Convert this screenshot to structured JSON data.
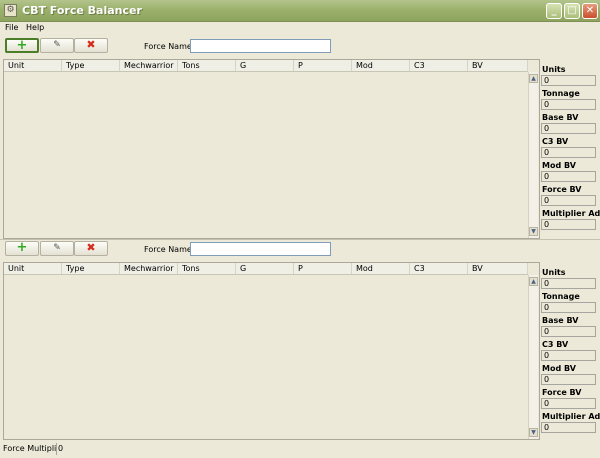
{
  "window": {
    "title": "CBT Force Balancer",
    "minimize_label": "_",
    "maximize_label": "□",
    "close_label": "✕"
  },
  "menu": {
    "items": [
      "File",
      "Help"
    ]
  },
  "toolbar": {
    "add_icon": "+",
    "edit_icon": "✎",
    "delete_icon": "✖"
  },
  "force1": {
    "force_name_label": "Force Name:",
    "force_name_value": "",
    "columns": [
      "Unit",
      "Type",
      "Mechwarrior",
      "Tons",
      "G",
      "P",
      "Mod",
      "C3",
      "BV"
    ],
    "stats": [
      {
        "label": "Units",
        "value": "0"
      },
      {
        "label": "Tonnage",
        "value": "0"
      },
      {
        "label": "Base BV",
        "value": "0"
      },
      {
        "label": "C3 BV",
        "value": "0"
      },
      {
        "label": "Mod BV",
        "value": "0"
      },
      {
        "label": "Force BV",
        "value": "0"
      },
      {
        "label": "Multiplier Adj",
        "value": "0"
      }
    ]
  },
  "force2": {
    "force_name_label": "Force Name:",
    "force_name_value": "",
    "columns": [
      "Unit",
      "Type",
      "Mechwarrior",
      "Tons",
      "G",
      "P",
      "Mod",
      "C3",
      "BV"
    ],
    "stats": [
      {
        "label": "Units",
        "value": "0"
      },
      {
        "label": "Tonnage",
        "value": "0"
      },
      {
        "label": "Base BV",
        "value": "0"
      },
      {
        "label": "C3 BV",
        "value": "0"
      },
      {
        "label": "Mod BV",
        "value": "0"
      },
      {
        "label": "Force BV",
        "value": "0"
      },
      {
        "label": "Multiplier Adj",
        "value": "0"
      }
    ]
  },
  "footer": {
    "label": "Force Multiplier",
    "value": "0"
  },
  "colors": {
    "titlebar": "#9cb26c",
    "window_bg": "#ece9d8"
  }
}
